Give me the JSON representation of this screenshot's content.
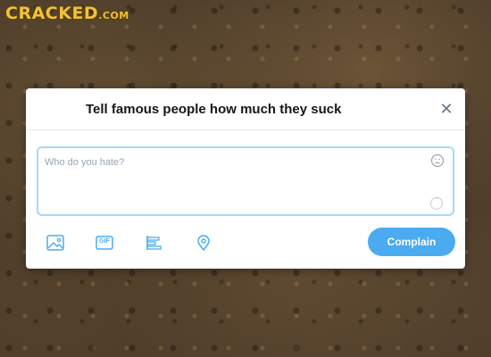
{
  "brand": {
    "logo_text": "CRACKED",
    "logo_suffix": ".COM"
  },
  "dialog": {
    "title": "Tell famous people how much they suck",
    "close_symbol": "✕",
    "compose": {
      "value": "",
      "placeholder": "Who do you hate?"
    },
    "toolbar": {
      "icons": [
        "image-icon",
        "gif-icon",
        "poll-icon",
        "location-icon"
      ],
      "gif_label": "GIF",
      "submit_label": "Complain"
    }
  },
  "colors": {
    "accent": "#4aabf0",
    "input_border": "#a4d9f9",
    "icon": "#4aabf0",
    "logo": "#f0c23a"
  }
}
